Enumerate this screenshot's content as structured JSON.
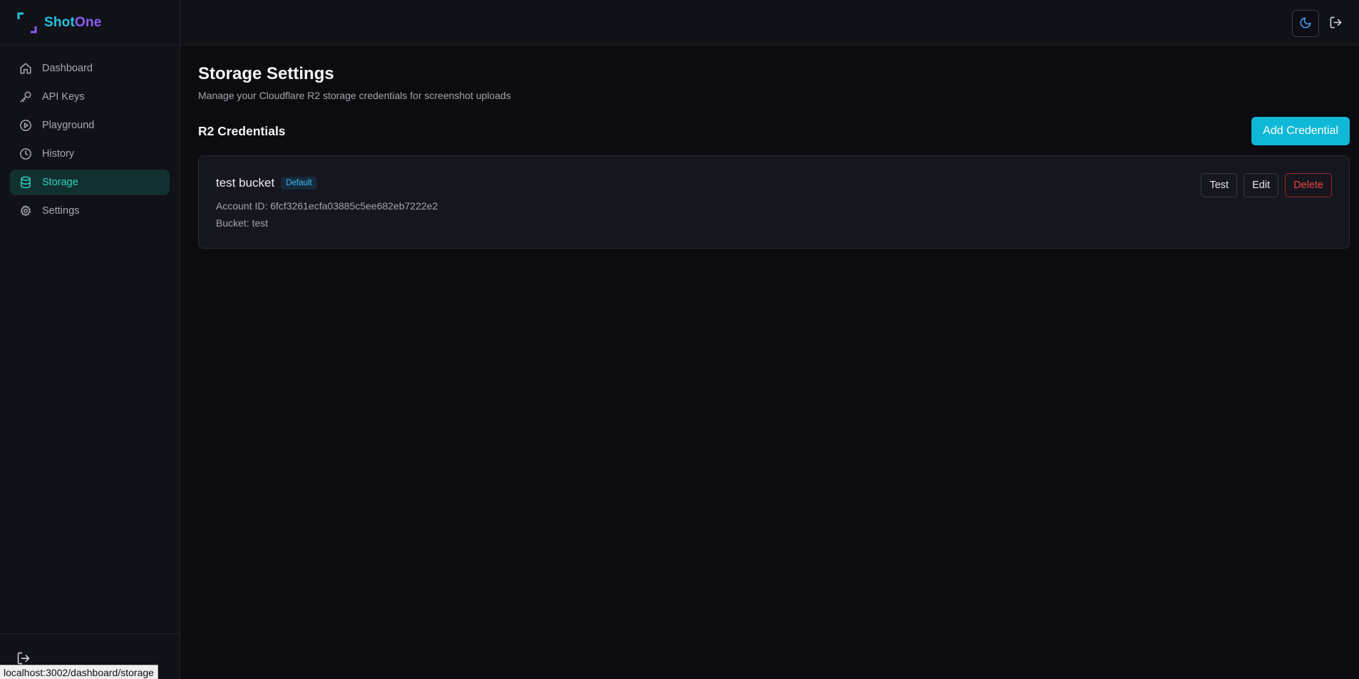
{
  "brand": {
    "part1": "Shot",
    "part2": "One"
  },
  "sidebar": {
    "items": [
      {
        "label": "Dashboard",
        "icon": "home-icon"
      },
      {
        "label": "API Keys",
        "icon": "key-icon"
      },
      {
        "label": "Playground",
        "icon": "play-circle-icon"
      },
      {
        "label": "History",
        "icon": "clock-icon"
      },
      {
        "label": "Storage",
        "icon": "database-icon",
        "active": true
      },
      {
        "label": "Settings",
        "icon": "gear-icon"
      }
    ]
  },
  "page": {
    "title": "Storage Settings",
    "subtitle": "Manage your Cloudflare R2 storage credentials for screenshot uploads"
  },
  "section": {
    "title": "R2 Credentials",
    "add_label": "Add Credential"
  },
  "credential": {
    "name": "test bucket",
    "badge": "Default",
    "account_id": "Account ID: 6fcf3261ecfa03885c5ee682eb7222e2",
    "bucket": "Bucket: test",
    "actions": {
      "test": "Test",
      "edit": "Edit",
      "delete": "Delete"
    }
  },
  "status_url": "localhost:3002/dashboard/storage",
  "colors": {
    "accent": "#0fb8d6",
    "active_nav": "#2dd4bf",
    "danger": "#ef4444",
    "brand_purple": "#8b5cf6"
  }
}
